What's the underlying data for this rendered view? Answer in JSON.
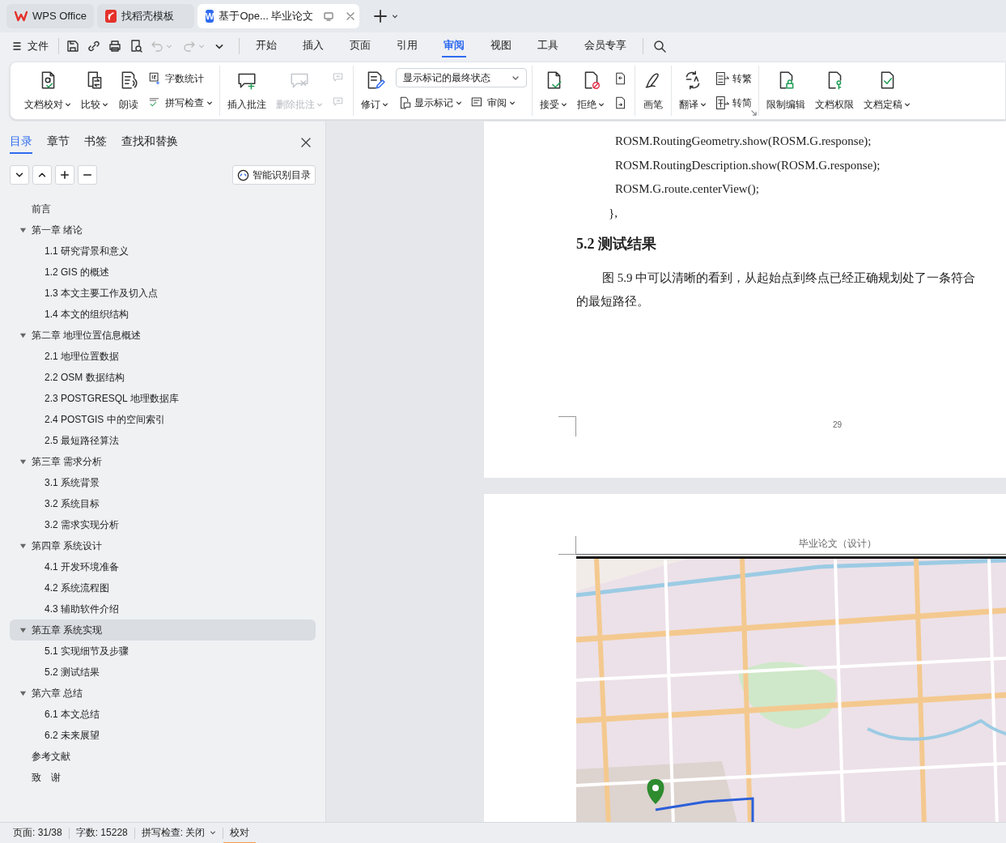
{
  "tabs": [
    {
      "kind": "home",
      "label": "WPS Office",
      "selected": false
    },
    {
      "kind": "templates",
      "label": "找稻壳模板",
      "selected": false
    },
    {
      "kind": "document",
      "badge": "W",
      "label": "基于Ope... 毕业论文",
      "selected": true
    }
  ],
  "menu": {
    "file": "文件",
    "tabs": [
      {
        "label": "开始",
        "selected": false
      },
      {
        "label": "插入",
        "selected": false
      },
      {
        "label": "页面",
        "selected": false
      },
      {
        "label": "引用",
        "selected": false
      },
      {
        "label": "审阅",
        "selected": true
      },
      {
        "label": "视图",
        "selected": false
      },
      {
        "label": "工具",
        "selected": false
      },
      {
        "label": "会员专享",
        "selected": false
      }
    ]
  },
  "ribbon": {
    "groups": [
      {
        "items": [
          {
            "kind": "large",
            "label": "文档校对",
            "dropdown": true,
            "disabled": false
          },
          {
            "kind": "large",
            "label": "比较",
            "dropdown": true,
            "disabled": false
          },
          {
            "kind": "large",
            "label": "朗读",
            "dropdown": false,
            "disabled": false
          },
          {
            "kind": "stack",
            "top": [
              {
                "kind": "small",
                "label": "字数统计",
                "dropdown": false,
                "disabled": false
              }
            ],
            "bottom": [
              {
                "kind": "small",
                "label": "拼写检查",
                "dropdown": true,
                "disabled": false
              }
            ]
          }
        ]
      },
      {
        "items": [
          {
            "kind": "large",
            "label": "插入批注",
            "dropdown": false,
            "disabled": false
          },
          {
            "kind": "large",
            "label": "删除批注",
            "dropdown": true,
            "disabled": true
          },
          {
            "kind": "stack",
            "top": [
              {
                "kind": "small",
                "dropdown": false,
                "disabled": true
              }
            ],
            "bottom": [
              {
                "kind": "small",
                "dropdown": false,
                "disabled": true
              }
            ]
          }
        ]
      },
      {
        "items": [
          {
            "kind": "large",
            "label": "修订",
            "dropdown": true,
            "disabled": false
          },
          {
            "kind": "stack",
            "top": [
              {
                "kind": "select",
                "value": "显示标记的最终状态"
              }
            ],
            "bottom": [
              {
                "kind": "small",
                "label": "显示标记",
                "dropdown": true,
                "disabled": false
              },
              {
                "kind": "small",
                "label": "审阅",
                "dropdown": true,
                "disabled": false
              }
            ]
          }
        ]
      },
      {
        "items": [
          {
            "kind": "large",
            "label": "接受",
            "dropdown": true,
            "disabled": false
          },
          {
            "kind": "large",
            "label": "拒绝",
            "dropdown": true,
            "disabled": false
          },
          {
            "kind": "stack",
            "top": [
              {
                "kind": "small",
                "dropdown": false,
                "disabled": false
              }
            ],
            "bottom": [
              {
                "kind": "small",
                "dropdown": false,
                "disabled": false
              }
            ]
          }
        ]
      },
      {
        "items": [
          {
            "kind": "large",
            "label": "画笔",
            "dropdown": false,
            "disabled": false
          }
        ]
      },
      {
        "launcher": true,
        "items": [
          {
            "kind": "large",
            "label": "翻译",
            "dropdown": true,
            "disabled": false
          },
          {
            "kind": "stack",
            "top": [
              {
                "kind": "small",
                "label": "转繁",
                "dropdown": false,
                "disabled": false
              }
            ],
            "bottom": [
              {
                "kind": "small",
                "label": "转简",
                "dropdown": false,
                "disabled": false
              }
            ]
          }
        ]
      },
      {
        "items": [
          {
            "kind": "large",
            "label": "限制编辑",
            "dropdown": false,
            "disabled": false
          },
          {
            "kind": "large",
            "label": "文档权限",
            "dropdown": false,
            "disabled": false
          },
          {
            "kind": "large",
            "label": "文档定稿",
            "dropdown": true,
            "disabled": false
          }
        ]
      }
    ]
  },
  "navigation": {
    "tabs": [
      {
        "label": "目录",
        "selected": true
      },
      {
        "label": "章节",
        "selected": false
      },
      {
        "label": "书签",
        "selected": false
      },
      {
        "label": "查找和替换",
        "selected": false
      }
    ],
    "smart_button": "智能识别目录",
    "items": [
      {
        "label": "前言",
        "selected": false
      },
      {
        "label": "第一章 绪论",
        "selected": false,
        "expanded": true,
        "children": [
          {
            "label": "1.1 研究背景和意义",
            "selected": false
          },
          {
            "label": "1.2 GIS 的概述",
            "selected": false
          },
          {
            "label": "1.3 本文主要工作及切入点",
            "selected": false
          },
          {
            "label": "1.4 本文的组织结构",
            "selected": false
          }
        ]
      },
      {
        "label": "第二章 地理位置信息概述",
        "selected": false,
        "expanded": true,
        "children": [
          {
            "label": "2.1 地理位置数据",
            "selected": false
          },
          {
            "label": "2.2 OSM 数据结构",
            "selected": false
          },
          {
            "label": "2.3 POSTGRESQL 地理数据库",
            "selected": false
          },
          {
            "label": "2.4 POSTGIS 中的空间索引",
            "selected": false
          },
          {
            "label": "2.5 最短路径算法",
            "selected": false
          }
        ]
      },
      {
        "label": "第三章 需求分析",
        "selected": false,
        "expanded": true,
        "children": [
          {
            "label": "3.1 系统背景",
            "selected": false
          },
          {
            "label": "3.2 系统目标",
            "selected": false
          },
          {
            "label": "3.2 需求实现分析",
            "selected": false
          }
        ]
      },
      {
        "label": "第四章 系统设计",
        "selected": false,
        "expanded": true,
        "children": [
          {
            "label": "4.1 开发环境准备",
            "selected": false
          },
          {
            "label": "4.2 系统流程图",
            "selected": false
          },
          {
            "label": "4.3 辅助软件介绍",
            "selected": false
          }
        ]
      },
      {
        "label": "第五章 系统实现",
        "selected": true,
        "expanded": true,
        "children": [
          {
            "label": "5.1 实现细节及步骤",
            "selected": false
          },
          {
            "label": "5.2 测试结果",
            "selected": false
          }
        ]
      },
      {
        "label": "第六章 总结",
        "selected": false,
        "expanded": true,
        "children": [
          {
            "label": "6.1 本文总结",
            "selected": false
          },
          {
            "label": "6.2 未来展望",
            "selected": false
          }
        ]
      },
      {
        "label": "参考文献",
        "selected": false
      },
      {
        "label": "致　谢",
        "selected": false
      }
    ]
  },
  "document": {
    "page1": {
      "code_lines": [
        "ROSM.RoutingGeometry.show(ROSM.G.response);",
        "ROSM.RoutingDescription.show(ROSM.G.response);",
        "ROSM.G.route.centerView();"
      ],
      "closing": "},",
      "heading": "5.2 测试结果",
      "paragraph_lines": [
        "图 5.9 中可以清晰的看到，从起始点到终点已经正确规划处了一条符合",
        "的最短路径。"
      ],
      "page_number": "29"
    },
    "page2": {
      "header": "毕业论文（设计）"
    }
  },
  "status_bar": [
    {
      "text": "页面: 31/38",
      "dropdown": false,
      "selected": false
    },
    {
      "text": "字数: 15228",
      "dropdown": false,
      "selected": false
    },
    {
      "text": "拼写检查: 关闭",
      "dropdown": true,
      "selected": false
    },
    {
      "text": "校对",
      "dropdown": false,
      "selected": true
    }
  ]
}
